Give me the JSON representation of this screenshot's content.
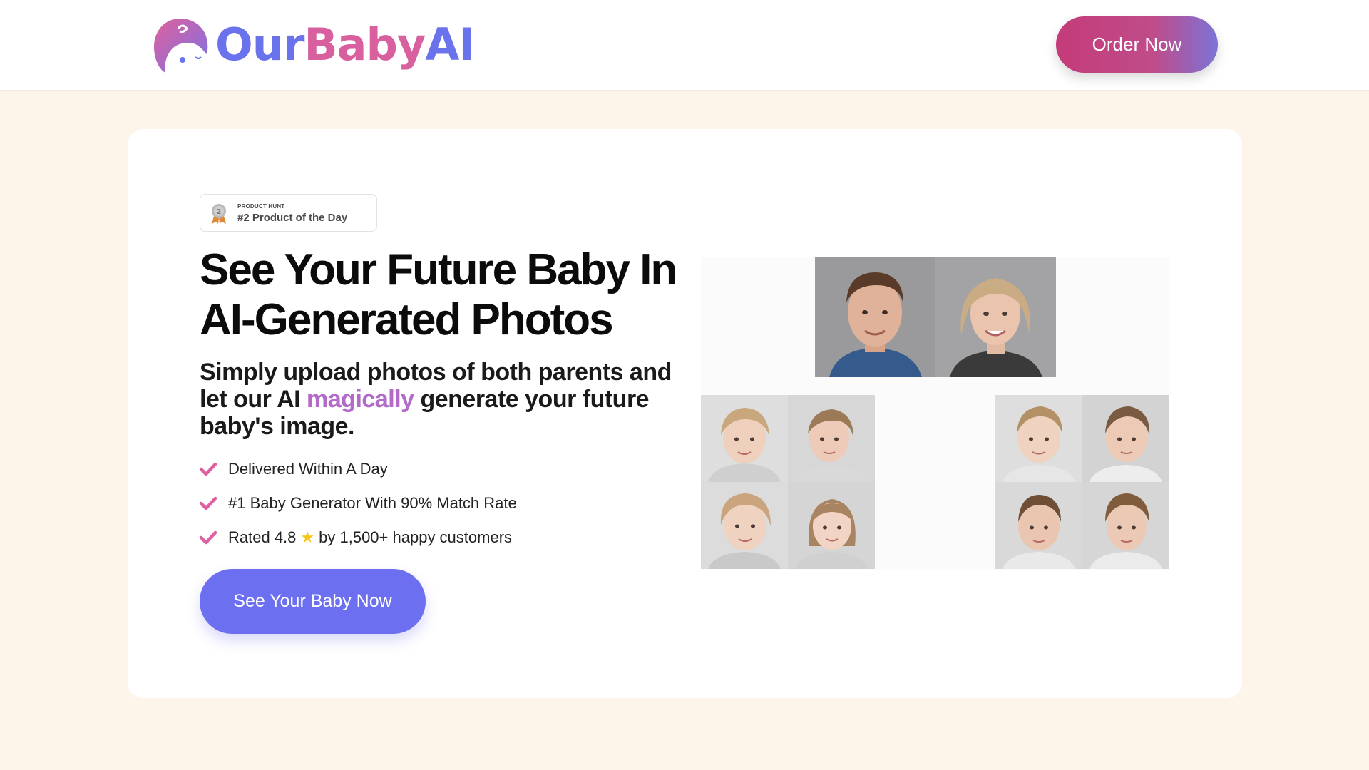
{
  "header": {
    "logo": {
      "part1": "Our",
      "part2": "Baby",
      "part3": "AI"
    },
    "order_button": "Order Now"
  },
  "badge": {
    "kicker": "PRODUCT HUNT",
    "title": "#2 Product of the Day"
  },
  "hero": {
    "headline_line1": "See Your Future Baby In",
    "headline_line2": "AI-Generated Photos",
    "subhead_before": "Simply upload photos of both parents and let our AI ",
    "subhead_highlight": "magically",
    "subhead_after": " generate your future baby's image."
  },
  "features": [
    {
      "text": "Delivered Within A Day"
    },
    {
      "text": "#1 Baby Generator With 90% Match Rate"
    },
    {
      "text_before": "Rated 4.8",
      "icon": "star-icon",
      "text_after": "by 1,500+ happy customers"
    }
  ],
  "cta_button": "See Your Baby Now",
  "colors": {
    "page_bg": "#fdf4ea",
    "brand_blue": "#6b73ec",
    "brand_pink": "#d8609f",
    "cta": "#6b6ff0",
    "check": "#e05fa0"
  }
}
